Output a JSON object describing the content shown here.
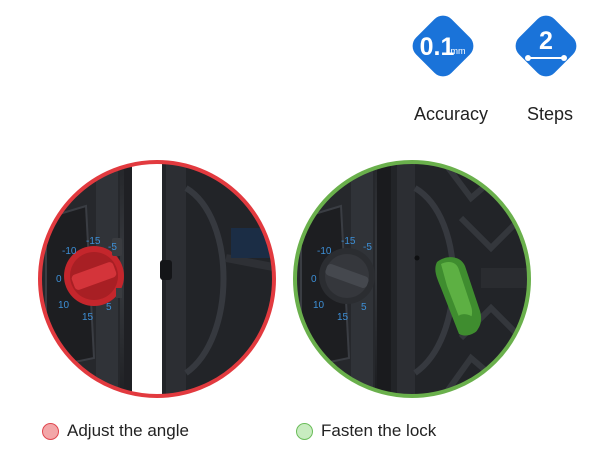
{
  "colors": {
    "badge_blue": "#1a73d9",
    "red_ring": "#e23a3f",
    "red_dot_fill": "#f3a6a8",
    "green_ring": "#6ab04c",
    "green_dot_fill": "#c8ecc0",
    "scale_blue": "#3d8fd6"
  },
  "badges": [
    {
      "value": "0.1",
      "unit": "mm",
      "caption": "Accuracy",
      "icon": "accuracy-diamond-icon"
    },
    {
      "value": "2",
      "caption": "Steps",
      "icon": "steps-diamond-icon"
    }
  ],
  "photos": {
    "left": {
      "icon": "angle-adjust-photo",
      "scale_labels": [
        "-10",
        "-15",
        "-5",
        "0",
        "10",
        "15",
        "5"
      ]
    },
    "right": {
      "icon": "lock-fasten-photo",
      "scale_labels": [
        "-10",
        "-15",
        "-5",
        "0",
        "10",
        "15",
        "5"
      ]
    }
  },
  "legend": [
    {
      "label": "Adjust the angle",
      "color": "red"
    },
    {
      "label": "Fasten the lock",
      "color": "green"
    }
  ]
}
